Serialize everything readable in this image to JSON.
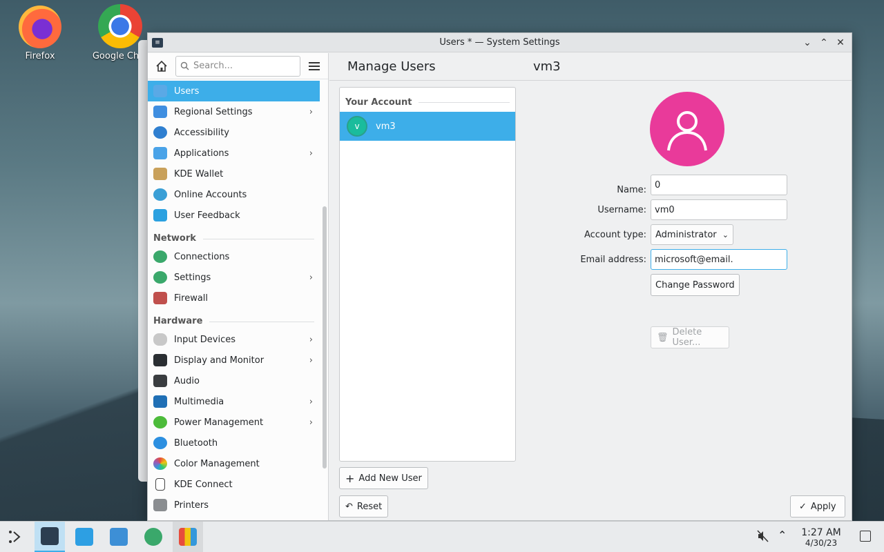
{
  "desktop": {
    "icons": [
      {
        "label": "Firefox"
      },
      {
        "label": "Google Chro"
      }
    ]
  },
  "window": {
    "title": "Users * — System Settings",
    "controls": {
      "minimize": "⌄",
      "maximize": "⌃",
      "close": "✕"
    }
  },
  "sidebar": {
    "search_placeholder": "Search...",
    "items": [
      {
        "label": "Users",
        "active": true
      },
      {
        "label": "Regional Settings",
        "chevron": true
      },
      {
        "label": "Accessibility"
      },
      {
        "label": "Applications",
        "chevron": true
      },
      {
        "label": "KDE Wallet"
      },
      {
        "label": "Online Accounts"
      },
      {
        "label": "User Feedback"
      }
    ],
    "network_header": "Network",
    "network_items": [
      {
        "label": "Connections"
      },
      {
        "label": "Settings",
        "chevron": true
      },
      {
        "label": "Firewall"
      }
    ],
    "hardware_header": "Hardware",
    "hardware_items": [
      {
        "label": "Input Devices",
        "chevron": true
      },
      {
        "label": "Display and Monitor",
        "chevron": true
      },
      {
        "label": "Audio"
      },
      {
        "label": "Multimedia",
        "chevron": true
      },
      {
        "label": "Power Management",
        "chevron": true
      },
      {
        "label": "Bluetooth"
      },
      {
        "label": "Color Management"
      },
      {
        "label": "KDE Connect"
      },
      {
        "label": "Printers"
      }
    ]
  },
  "header": {
    "page_title": "Manage Users",
    "selected_user": "vm3"
  },
  "user_list": {
    "section": "Your Account",
    "users": [
      {
        "initial": "v",
        "name": "vm3"
      }
    ]
  },
  "form": {
    "name_label": "Name:",
    "name_value": "0",
    "username_label": "Username:",
    "username_value": "vm0",
    "account_type_label": "Account type:",
    "account_type_value": "Administrator",
    "email_label": "Email address:",
    "email_value": "microsoft@email.",
    "change_password": "Change Password",
    "delete_user": "Delete User..."
  },
  "buttons": {
    "add_new_user": "Add New User",
    "reset": "Reset",
    "apply": "Apply"
  },
  "taskbar": {
    "time": "1:27 AM",
    "date": "4/30/23"
  },
  "colors": {
    "accent": "#3daee9",
    "avatar": "#e93a9a"
  }
}
